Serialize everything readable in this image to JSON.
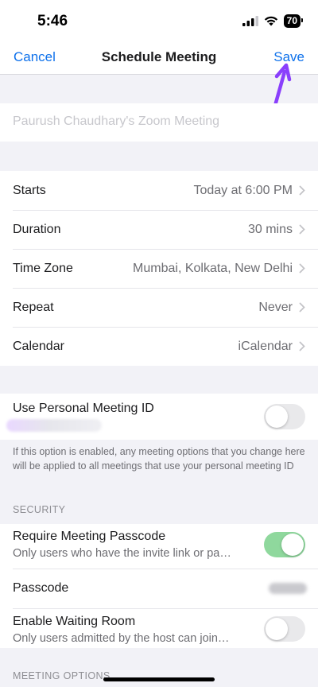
{
  "status_bar": {
    "time": "5:46",
    "battery": "70"
  },
  "nav": {
    "cancel": "Cancel",
    "title": "Schedule Meeting",
    "save": "Save"
  },
  "topic": {
    "placeholder": "Paurush Chaudhary's Zoom Meeting"
  },
  "rows": {
    "starts": {
      "label": "Starts",
      "value": "Today at 6:00 PM"
    },
    "duration": {
      "label": "Duration",
      "value": "30 mins"
    },
    "timezone": {
      "label": "Time Zone",
      "value": "Mumbai, Kolkata, New Delhi"
    },
    "repeat": {
      "label": "Repeat",
      "value": "Never"
    },
    "calendar": {
      "label": "Calendar",
      "value": "iCalendar"
    }
  },
  "pmi": {
    "label": "Use Personal Meeting ID",
    "enabled": false,
    "note": "If this option is enabled, any meeting options that you change here will be applied to all meetings that use your personal meeting ID"
  },
  "security": {
    "header": "SECURITY",
    "require_passcode": {
      "title": "Require Meeting Passcode",
      "subtitle": "Only users who have the invite link or pa…",
      "enabled": true
    },
    "passcode": {
      "label": "Passcode"
    },
    "waiting_room": {
      "title": "Enable Waiting Room",
      "subtitle": "Only users admitted by the host can join…",
      "enabled": false
    }
  },
  "meeting_options": {
    "header": "MEETING OPTIONS"
  },
  "colors": {
    "accent": "#0e71eb",
    "toggle_on": "#8fd89d",
    "annotation_arrow": "#8a3ffc"
  }
}
